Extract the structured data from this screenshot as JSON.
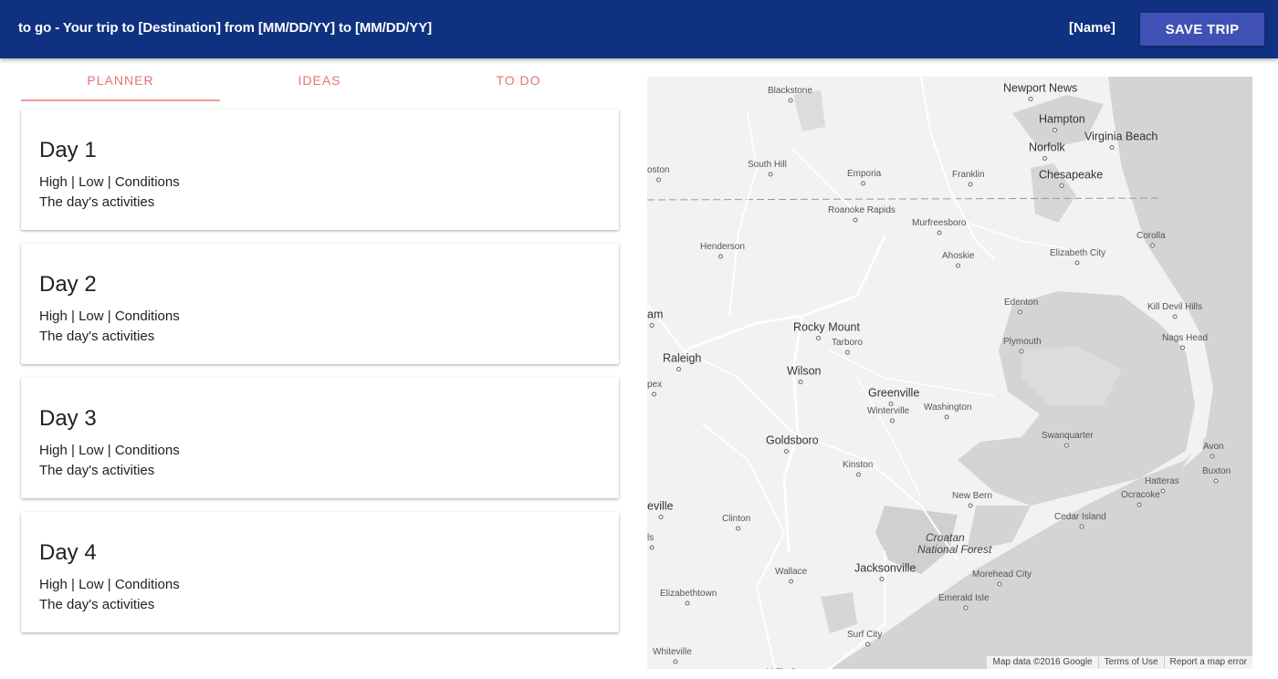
{
  "appbar": {
    "title": "to go - Your trip to [Destination] from [MM/DD/YY] to [MM/DD/YY]",
    "user_name": "[Name]",
    "save_label": "SAVE TRIP"
  },
  "tabs": [
    {
      "label": "PLANNER",
      "active": true
    },
    {
      "label": "IDEAS",
      "active": false
    },
    {
      "label": "TO DO",
      "active": false
    }
  ],
  "days": [
    {
      "title": "Day 1",
      "weather": "High | Low | Conditions",
      "activities": "The day's activities"
    },
    {
      "title": "Day 2",
      "weather": "High | Low | Conditions",
      "activities": "The day's activities"
    },
    {
      "title": "Day 3",
      "weather": "High | Low | Conditions",
      "activities": "The day's activities"
    },
    {
      "title": "Day 4",
      "weather": "High | Low | Conditions",
      "activities": "The day's activities"
    }
  ],
  "map": {
    "cities": [
      {
        "name": "Blackstone",
        "size": "small"
      },
      {
        "name": "Newport News",
        "size": "medium"
      },
      {
        "name": "Hampton",
        "size": "medium"
      },
      {
        "name": "Virginia Beach",
        "size": "medium"
      },
      {
        "name": "Norfolk",
        "size": "medium"
      },
      {
        "name": "Chesapeake",
        "size": "medium"
      },
      {
        "name": "South Hill",
        "size": "small"
      },
      {
        "name": "Emporia",
        "size": "small"
      },
      {
        "name": "Franklin",
        "size": "small"
      },
      {
        "name": "oston",
        "size": "small"
      },
      {
        "name": "Roanoke Rapids",
        "size": "small"
      },
      {
        "name": "Murfreesboro",
        "size": "small"
      },
      {
        "name": "Corolla",
        "size": "small"
      },
      {
        "name": "Henderson",
        "size": "small"
      },
      {
        "name": "Ahoskie",
        "size": "small"
      },
      {
        "name": "Elizabeth City",
        "size": "small"
      },
      {
        "name": "Edenton",
        "size": "small"
      },
      {
        "name": "Kill Devil Hills",
        "size": "small"
      },
      {
        "name": "am",
        "size": "medium"
      },
      {
        "name": "Rocky Mount",
        "size": "medium"
      },
      {
        "name": "Tarboro",
        "size": "small"
      },
      {
        "name": "Plymouth",
        "size": "small"
      },
      {
        "name": "Nags Head",
        "size": "small"
      },
      {
        "name": "Raleigh",
        "size": "medium"
      },
      {
        "name": "Wilson",
        "size": "medium"
      },
      {
        "name": "pex",
        "size": "small"
      },
      {
        "name": "Greenville",
        "size": "medium"
      },
      {
        "name": "Winterville",
        "size": "small"
      },
      {
        "name": "Washington",
        "size": "small"
      },
      {
        "name": "Goldsboro",
        "size": "medium"
      },
      {
        "name": "Swanquarter",
        "size": "small"
      },
      {
        "name": "Avon",
        "size": "small"
      },
      {
        "name": "Kinston",
        "size": "small"
      },
      {
        "name": "Hatteras",
        "size": "small"
      },
      {
        "name": "Buxton",
        "size": "small"
      },
      {
        "name": "Ocracoke",
        "size": "small"
      },
      {
        "name": "New Bern",
        "size": "small"
      },
      {
        "name": "eville",
        "size": "medium"
      },
      {
        "name": "Clinton",
        "size": "small"
      },
      {
        "name": "Cedar Island",
        "size": "small"
      },
      {
        "name": "Croatan",
        "size": "italic"
      },
      {
        "name": "National Forest",
        "size": "italic"
      },
      {
        "name": "ls",
        "size": "small"
      },
      {
        "name": "Jacksonville",
        "size": "medium"
      },
      {
        "name": "Wallace",
        "size": "small"
      },
      {
        "name": "Morehead City",
        "size": "small"
      },
      {
        "name": "Elizabethtown",
        "size": "small"
      },
      {
        "name": "Emerald Isle",
        "size": "small"
      },
      {
        "name": "Surf City",
        "size": "small"
      },
      {
        "name": "Whiteville",
        "size": "small"
      },
      {
        "name": "Wilmington",
        "size": "medium"
      }
    ],
    "footer": {
      "data": "Map data ©2016 Google",
      "terms": "Terms of Use",
      "report": "Report a map error"
    },
    "colors": {
      "land": "#f2f2f2",
      "water": "#d4d4d4",
      "forest": "#d7d7d7",
      "road": "#ffffff",
      "border": "#999999"
    }
  }
}
